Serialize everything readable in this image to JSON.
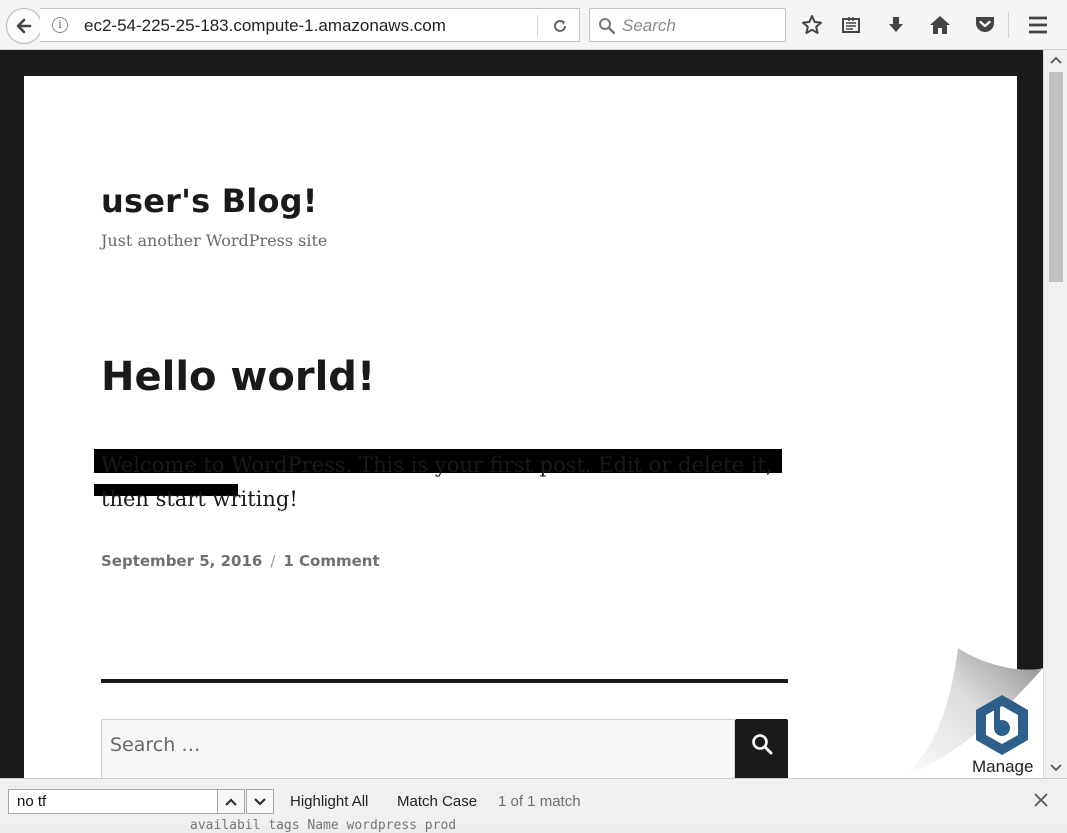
{
  "browser": {
    "url": "ec2-54-225-25-183.compute-1.amazonaws.com",
    "info_glyph": "i",
    "search_placeholder": "Search",
    "icons": [
      "back-arrow-icon",
      "info-icon",
      "reload-icon",
      "search-icon",
      "bookmark-star-icon",
      "reading-list-icon",
      "download-icon",
      "home-icon",
      "pocket-icon",
      "menu-icon"
    ]
  },
  "site": {
    "title": "user's Blog!",
    "description": "Just another WordPress site"
  },
  "post": {
    "title": "Hello world!",
    "body": "Welcome to WordPress. This is your first post. Edit or delete it, then start writing!",
    "date": "September 5, 2016",
    "separator": "/",
    "comments": "1 Comment"
  },
  "search_widget": {
    "placeholder": "Search …"
  },
  "extension": {
    "label": "Manage"
  },
  "findbar": {
    "query": "no tf",
    "highlight_all": "Highlight All",
    "match_case": "Match Case",
    "status": "1 of 1 match"
  },
  "terminal_peek": "availabil tags Name wordpress prod"
}
